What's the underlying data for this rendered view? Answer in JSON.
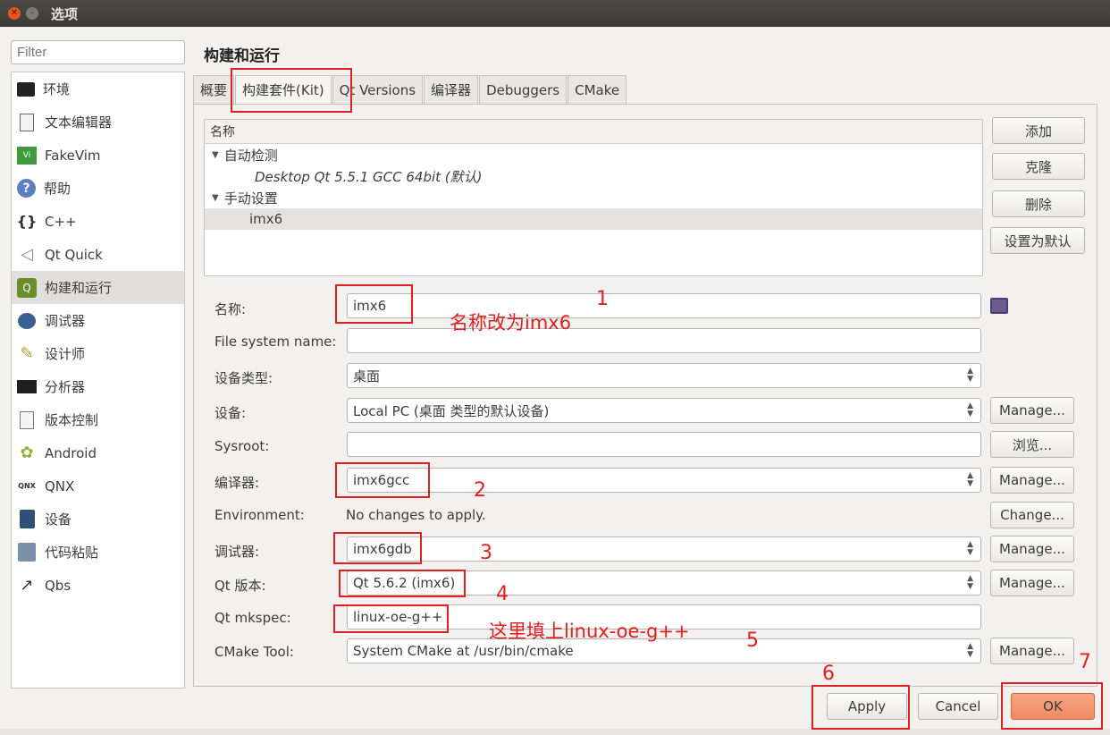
{
  "window": {
    "title": "选项"
  },
  "filter": {
    "placeholder": "Filter"
  },
  "sidebar": {
    "items": [
      {
        "label": "环境",
        "icon": "monitor-icon"
      },
      {
        "label": "文本编辑器",
        "icon": "text-editor-icon"
      },
      {
        "label": "FakeVim",
        "icon": "fakevim-icon"
      },
      {
        "label": "帮助",
        "icon": "help-icon"
      },
      {
        "label": "C++",
        "icon": "braces-icon"
      },
      {
        "label": "Qt Quick",
        "icon": "qt-quick-icon"
      },
      {
        "label": "构建和运行",
        "icon": "build-run-icon",
        "selected": true
      },
      {
        "label": "调试器",
        "icon": "debugger-icon"
      },
      {
        "label": "设计师",
        "icon": "designer-icon"
      },
      {
        "label": "分析器",
        "icon": "analyzer-icon"
      },
      {
        "label": "版本控制",
        "icon": "version-control-icon"
      },
      {
        "label": "Android",
        "icon": "android-icon"
      },
      {
        "label": "QNX",
        "icon": "qnx-icon"
      },
      {
        "label": "设备",
        "icon": "device-icon"
      },
      {
        "label": "代码粘贴",
        "icon": "code-paste-icon"
      },
      {
        "label": "Qbs",
        "icon": "qbs-icon"
      }
    ]
  },
  "main": {
    "title": "构建和运行",
    "tabs": [
      {
        "label": "概要"
      },
      {
        "label": "构建套件(Kit)",
        "active": true
      },
      {
        "label": "Qt Versions"
      },
      {
        "label": "编译器"
      },
      {
        "label": "Debuggers"
      },
      {
        "label": "CMake"
      }
    ]
  },
  "kit_list": {
    "header": "名称",
    "groups": [
      {
        "label": "自动检测",
        "children": [
          "Desktop Qt 5.5.1 GCC 64bit (默认)"
        ]
      },
      {
        "label": "手动设置",
        "children": [
          "imx6"
        ]
      }
    ]
  },
  "kit_buttons": {
    "add": "添加",
    "clone": "克隆",
    "remove": "删除",
    "set_default": "设置为默认"
  },
  "form": {
    "name": {
      "label": "名称:",
      "value": "imx6"
    },
    "fs_name": {
      "label": "File system name:",
      "value": ""
    },
    "device_type": {
      "label": "设备类型:",
      "value": "桌面"
    },
    "device": {
      "label": "设备:",
      "value": "Local PC (桌面 类型的默认设备)"
    },
    "sysroot": {
      "label": "Sysroot:",
      "value": ""
    },
    "compiler": {
      "label": "编译器:",
      "value": "imx6gcc"
    },
    "environment": {
      "label": "Environment:",
      "value": "No changes to apply."
    },
    "debugger": {
      "label": "调试器:",
      "value": "imx6gdb"
    },
    "qt_version": {
      "label": "Qt 版本:",
      "value": "Qt 5.6.2 (imx6)"
    },
    "mkspec": {
      "label": "Qt mkspec:",
      "value": "linux-oe-g++"
    },
    "cmake_tool": {
      "label": "CMake Tool:",
      "value": "System CMake at /usr/bin/cmake"
    }
  },
  "side_buttons": {
    "manage": "Manage...",
    "browse": "浏览...",
    "change": "Change..."
  },
  "dialog_buttons": {
    "apply": "Apply",
    "cancel": "Cancel",
    "ok": "OK"
  },
  "annotations": {
    "n1": "1",
    "n2": "2",
    "n3": "3",
    "n4": "4",
    "n5": "5",
    "n6": "6",
    "n7": "7",
    "note_name": "名称改为imx6",
    "note_mkspec": "这里填上linux-oe-g++"
  },
  "colors": {
    "annotation": "#e02020",
    "accent": "#e95420",
    "ok_button": "#f08a62"
  }
}
